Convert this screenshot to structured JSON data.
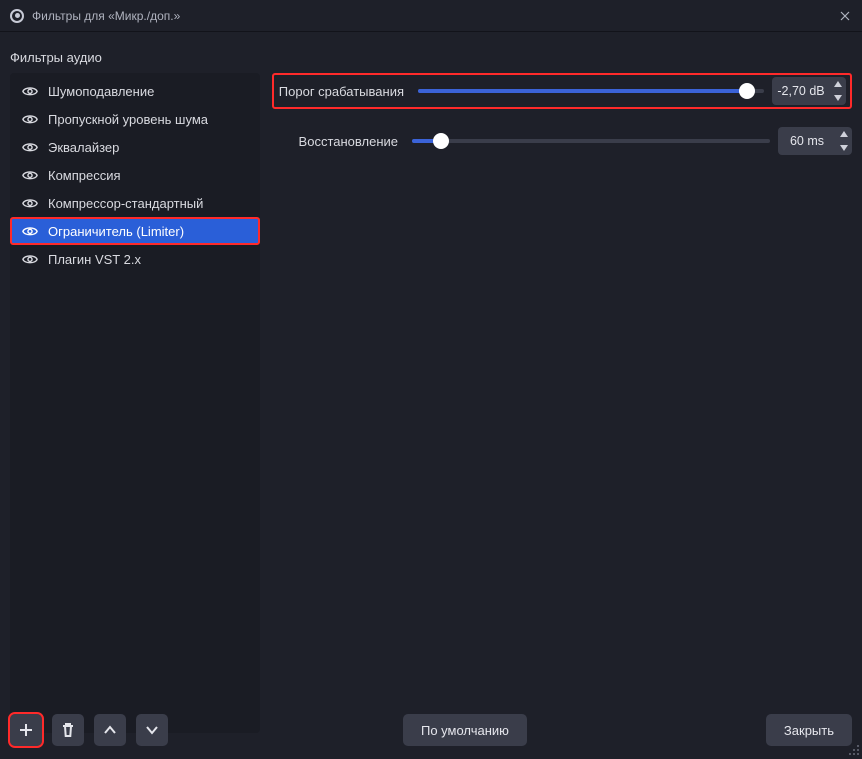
{
  "window": {
    "title": "Фильтры для «Микр./доп.»"
  },
  "section_label": "Фильтры аудио",
  "filters": [
    {
      "name": "Шумоподавление",
      "selected": false,
      "highlighted": false
    },
    {
      "name": "Пропускной уровень шума",
      "selected": false,
      "highlighted": false
    },
    {
      "name": "Эквалайзер",
      "selected": false,
      "highlighted": false
    },
    {
      "name": "Компрессия",
      "selected": false,
      "highlighted": false
    },
    {
      "name": "Компрессор-стандартный",
      "selected": false,
      "highlighted": false
    },
    {
      "name": "Ограничитель (Limiter)",
      "selected": true,
      "highlighted": true
    },
    {
      "name": "Плагин VST 2.x",
      "selected": false,
      "highlighted": false
    }
  ],
  "settings": {
    "threshold": {
      "label": "Порог срабатывания",
      "value_text": "-2,70 dB",
      "fill_pct": 95,
      "highlighted": true
    },
    "release": {
      "label": "Восстановление",
      "value_text": "60 ms",
      "fill_pct": 8,
      "highlighted": false
    }
  },
  "buttons": {
    "defaults": "По умолчанию",
    "close": "Закрыть"
  },
  "highlights": {
    "add_button": true
  }
}
